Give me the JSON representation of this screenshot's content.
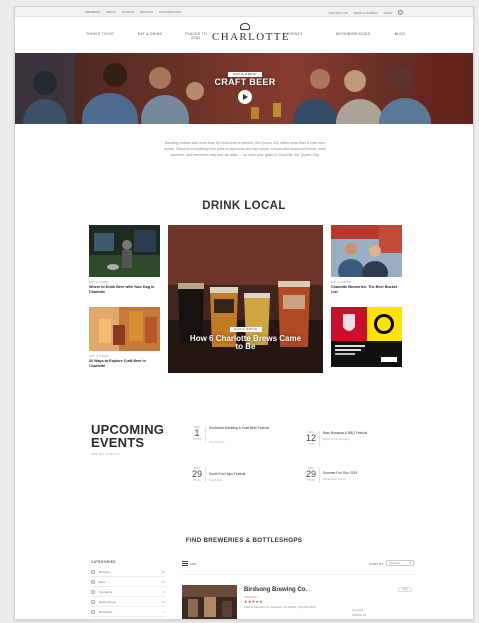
{
  "util_bar": {
    "left_links": [
      "MEMBERS",
      "MEDIA",
      "SPORTS",
      "GROUPS",
      "CONVENTIONS"
    ],
    "right_links": [
      "CONTACT US",
      "MAPS & GUIDES",
      "SHOP"
    ]
  },
  "nav": {
    "logo": "CHARLOTTE",
    "items": [
      "THINGS TO DO",
      "EAT & DRINK",
      "PLACES TO STAY",
      "EVENTS",
      "NEIGHBORHOODS",
      "BLOG"
    ]
  },
  "hero": {
    "tag": "EAT & DRINK",
    "title": "CRAFT BEER"
  },
  "intro": "Dazzling visitors with more than 60 local craft breweries, the Queen City offers more than a craft beer scene. Discover everything from pubs to taprooms and tap rooms, venues and seasonal events, local favorites, and breweries new and old alike — so raise your glass to Charlotte, the Queen City.",
  "drink_local": {
    "title": "DRINK LOCAL",
    "cards": [
      {
        "tag": "EAT & DRINK",
        "title": "Where to Drink Beer with Your Dog in Charlotte"
      },
      {
        "tag": "EAT & DRINK",
        "title": "20 Ways to Explore Craft Beer in Charlotte"
      },
      {
        "tag": "EAT & DRINK",
        "title": "Charlotte Breweries: The Beer Bucket List"
      }
    ],
    "feature": {
      "tag": "EAT & DRINK",
      "title": "How 6 Charlotte Brews Came to Be"
    }
  },
  "events": {
    "title_line1": "UPCOMING",
    "title_line2": "EVENTS",
    "link": "SEE ALL EVENTS",
    "items": [
      {
        "month": "NOV",
        "day": "1",
        "weekday": "THURS",
        "name": "Southeast Wedding & Craft Beer Festival",
        "meta": "The Fillmore"
      },
      {
        "month": "NOV",
        "day": "12",
        "weekday": "MON",
        "name": "Brau Bonanza & BBQ Festival",
        "meta": "Sugar Creek Brewing"
      },
      {
        "month": "NOV",
        "day": "29",
        "weekday": "THURS",
        "name": "South End Hops Festival",
        "meta": "South End"
      },
      {
        "month": "NOV",
        "day": "29",
        "weekday": "THURS",
        "name": "Summer Fun Run 2019",
        "meta": "Whitewater Center"
      }
    ]
  },
  "find": {
    "title": "FIND BREWERIES & BOTTLESHOPS",
    "filters_head": "CATEGORIES",
    "filters": [
      {
        "label": "Brewery",
        "count": "40"
      },
      {
        "label": "Bars",
        "count": "15"
      },
      {
        "label": "Taprooms",
        "count": "8"
      },
      {
        "label": "Bottle Shops",
        "count": "12"
      },
      {
        "label": "Brewpubs",
        "count": "6"
      },
      {
        "label": "Beer Gardens",
        "count": "5"
      }
    ],
    "list_label": "LIST",
    "sort_label": "SORT BY",
    "sort_value": "Featured",
    "result": {
      "name": "Birdsong Brewing Co.",
      "type": "BREWERY",
      "stars": "★★★★★",
      "address": "1016 N Davidson St, Charlotte, NC 28206 | 704-332-1810",
      "hours_label": "HOURS",
      "website_label": "WEBSITE",
      "fav_label": "SAVE"
    }
  },
  "colors": {
    "accent": "#c0392b",
    "hero_bg": "#6d3128"
  }
}
